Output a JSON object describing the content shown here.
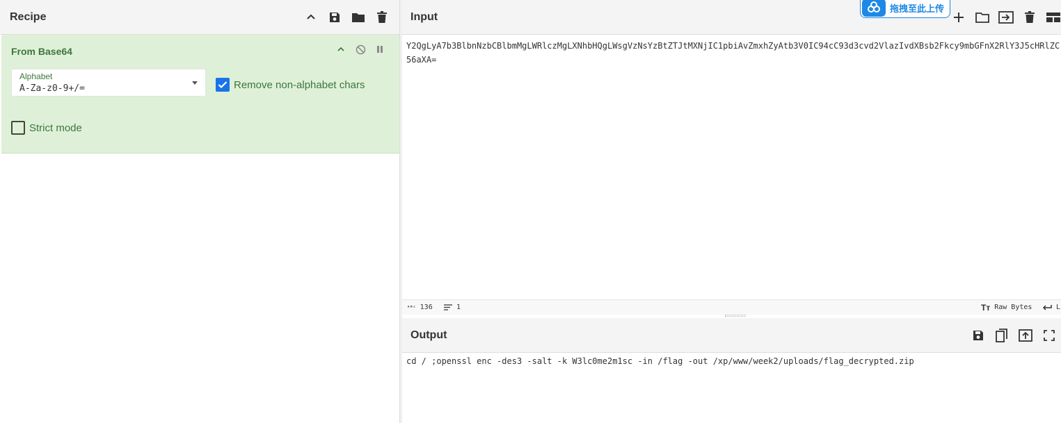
{
  "recipe": {
    "title": "Recipe",
    "icons": [
      "chevron-up-icon",
      "save-icon",
      "folder-icon",
      "trash-icon"
    ]
  },
  "operation": {
    "title": "From Base64",
    "alphabet_label": "Alphabet",
    "alphabet_value": "A-Za-z0-9+/=",
    "remove_nonalpha_label": "Remove non-alphabet chars",
    "remove_nonalpha_checked": true,
    "strict_mode_label": "Strict mode",
    "strict_mode_checked": false
  },
  "input": {
    "title": "Input",
    "text": "Y2QgLyA7b3BlbnNzbCBlbmMgLWRlczMgLXNhbHQgLWsgVzNsYzBtZTJtMXNjIC1pbiAvZmxhZyAtb3V0IC94cC93d3cvd2VlazIvdXBsb2Fkcy9mbGFnX2RlY3J5cHRlZC56aXA=",
    "upload_badge": "拖拽至此上传"
  },
  "status": {
    "length": "136",
    "lines": "1",
    "encoding": "Raw Bytes",
    "eol_label": "L"
  },
  "output": {
    "title": "Output",
    "text": "cd / ;openssl enc -des3 -salt -k W3lc0me2m1sc -in /flag -out /xp/www/week2/uploads/flag_decrypted.zip"
  },
  "colors": {
    "accent": "#1a73e8",
    "op_bg": "#dff0d8",
    "op_text": "#3c763d",
    "header_bg": "#f4f4f4"
  }
}
